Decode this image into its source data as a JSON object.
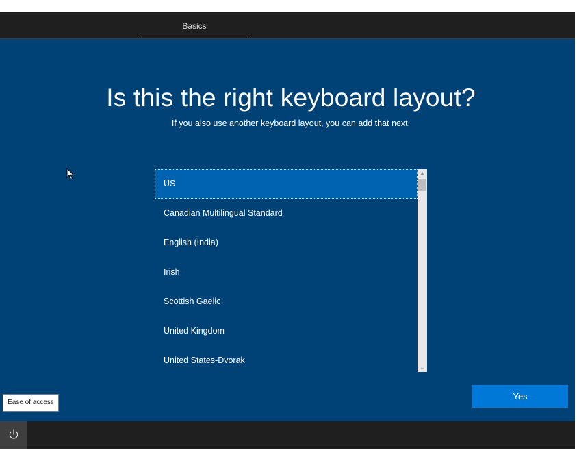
{
  "topbar": {
    "tab_label": "Basics"
  },
  "main": {
    "title": "Is this the right keyboard layout?",
    "subtitle": "If you also use another keyboard layout, you can add that next."
  },
  "layout_list": {
    "items": [
      "US",
      "Canadian Multilingual Standard",
      "English (India)",
      "Irish",
      "Scottish Gaelic",
      "United Kingdom",
      "United States-Dvorak"
    ],
    "selected_index": 0
  },
  "buttons": {
    "yes_label": "Yes",
    "ease_label": "Ease of access"
  },
  "icons": {
    "power": "power-icon",
    "cursor": "mouse-pointer-icon"
  },
  "colors": {
    "background": "#004275",
    "bar": "#1f1f1f",
    "selected": "#0063b1",
    "accent": "#0078d7"
  }
}
